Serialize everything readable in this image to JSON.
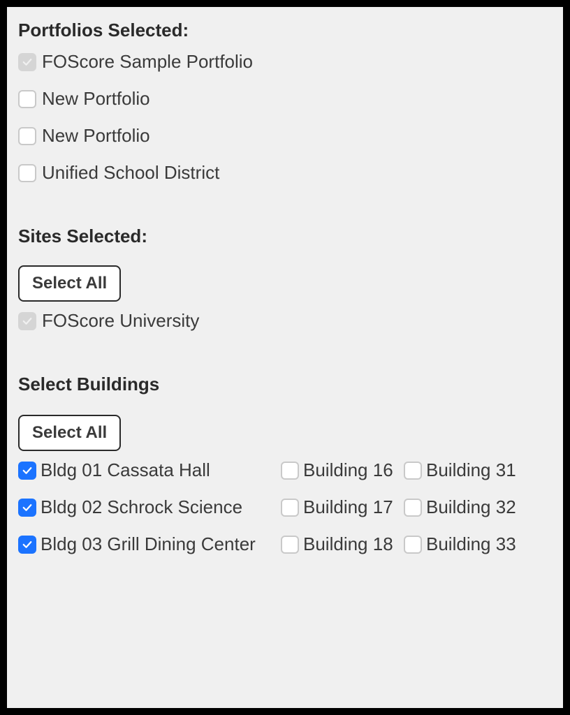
{
  "portfolios": {
    "heading": "Portfolios Selected:",
    "items": [
      {
        "label": "FOScore Sample Portfolio",
        "state": "disabled-checked"
      },
      {
        "label": "New Portfolio",
        "state": "empty"
      },
      {
        "label": "New Portfolio",
        "state": "empty"
      },
      {
        "label": "Unified School District",
        "state": "empty"
      }
    ]
  },
  "sites": {
    "heading": "Sites Selected:",
    "select_all": "Select All",
    "items": [
      {
        "label": "FOScore University",
        "state": "disabled-checked"
      }
    ]
  },
  "buildings": {
    "heading": "Select Buildings",
    "select_all": "Select All",
    "rows": [
      {
        "c1": {
          "label": "Bldg 01 Cassata Hall",
          "state": "checked"
        },
        "c2": {
          "label": "Building 16",
          "state": "empty"
        },
        "c3": {
          "label": "Building 31",
          "state": "empty"
        }
      },
      {
        "c1": {
          "label": "Bldg 02 Schrock Science",
          "state": "checked"
        },
        "c2": {
          "label": "Building 17",
          "state": "empty"
        },
        "c3": {
          "label": "Building 32",
          "state": "empty"
        }
      },
      {
        "c1": {
          "label": "Bldg 03 Grill Dining Center",
          "state": "checked"
        },
        "c2": {
          "label": "Building 18",
          "state": "empty"
        },
        "c3": {
          "label": "Building 33",
          "state": "empty"
        }
      }
    ]
  }
}
